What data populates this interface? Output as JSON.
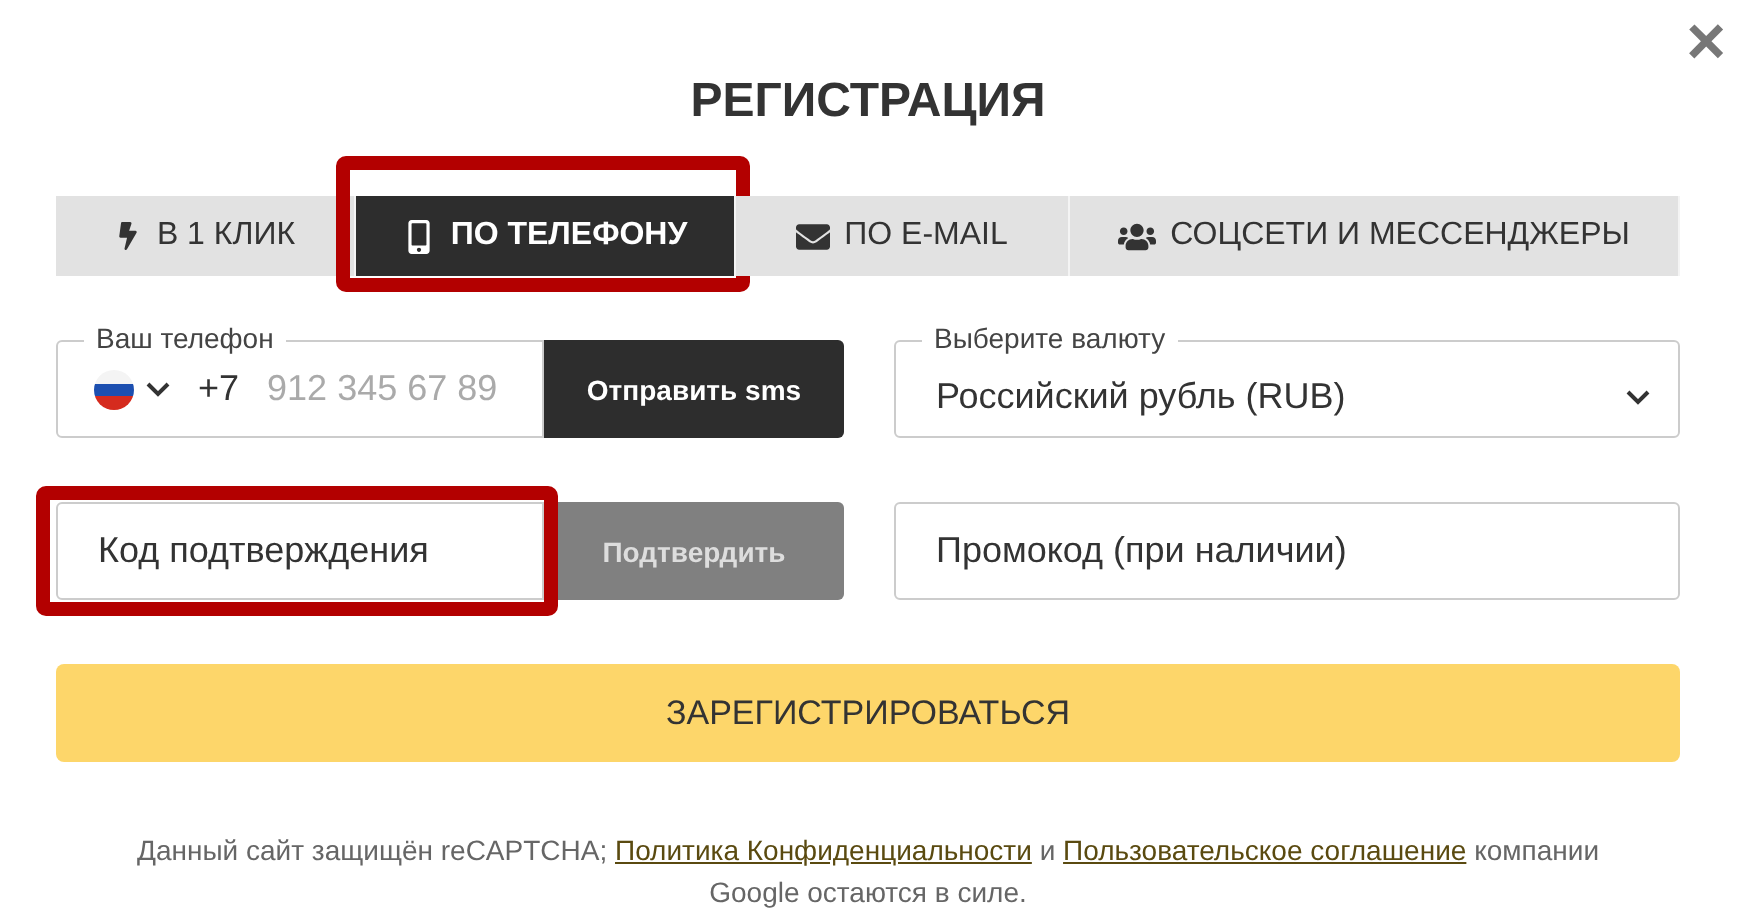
{
  "title": "РЕГИСТРАЦИЯ",
  "close": "×",
  "tabs": [
    {
      "label": "В 1 КЛИК",
      "kind": "bolt",
      "selected": false,
      "highlighted": false
    },
    {
      "label": "ПО ТЕЛЕФОНУ",
      "kind": "phone",
      "selected": true,
      "highlighted": true
    },
    {
      "label": "ПО E-MAIL",
      "kind": "mail",
      "selected": false,
      "highlighted": false
    },
    {
      "label": "СОЦСЕТИ И МЕССЕНДЖЕРЫ",
      "kind": "users",
      "selected": false,
      "highlighted": false
    }
  ],
  "phone": {
    "label": "Ваш телефон",
    "prefix": "+7",
    "placeholder": "912 345 67 89",
    "button": "Отправить sms"
  },
  "currency": {
    "label": "Выберите валюту",
    "value": "Российский рубль (RUB)"
  },
  "code": {
    "placeholder": "Код подтверждения",
    "button": "Подтвердить",
    "button_disabled": true,
    "highlighted": true
  },
  "promo": {
    "placeholder": "Промокод (при наличии)"
  },
  "submit": "ЗАРЕГИСТРИРОВАТЬСЯ",
  "footer": {
    "before": "Данный сайт защищён reCAPTCHA;",
    "link1": "Политика Конфиденциальности",
    "middle": "и",
    "link2": "Пользовательское соглашение",
    "after": "компании Google остаются в силе."
  }
}
